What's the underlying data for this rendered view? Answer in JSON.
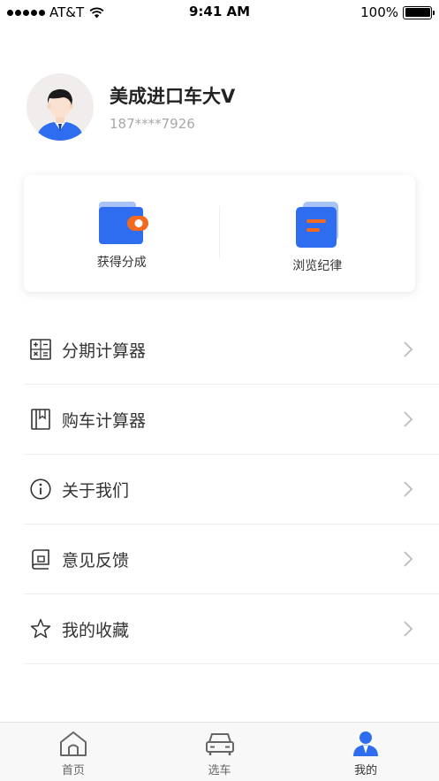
{
  "status_bar": {
    "carrier": "AT&T",
    "time": "9:41 AM",
    "battery": "100%"
  },
  "profile": {
    "name": "美成进口车大V",
    "phone": "187****7926"
  },
  "card": {
    "items": [
      {
        "label": "获得分成",
        "icon": "wallet-icon"
      },
      {
        "label": "浏览纪律",
        "icon": "document-icon"
      }
    ]
  },
  "menu": {
    "items": [
      {
        "label": "分期计算器",
        "icon": "calculator-icon"
      },
      {
        "label": "购车计算器",
        "icon": "book-icon"
      },
      {
        "label": "关于我们",
        "icon": "info-icon"
      },
      {
        "label": "意见反馈",
        "icon": "feedback-icon"
      },
      {
        "label": "我的收藏",
        "icon": "star-icon"
      }
    ]
  },
  "tabbar": {
    "tabs": [
      {
        "label": "首页",
        "icon": "home-icon"
      },
      {
        "label": "选车",
        "icon": "car-icon"
      },
      {
        "label": "我的",
        "icon": "person-icon",
        "active": true
      }
    ]
  },
  "colors": {
    "accent": "#2f6df0",
    "accent_light": "#a9c3f7",
    "orange": "#f26a21"
  }
}
